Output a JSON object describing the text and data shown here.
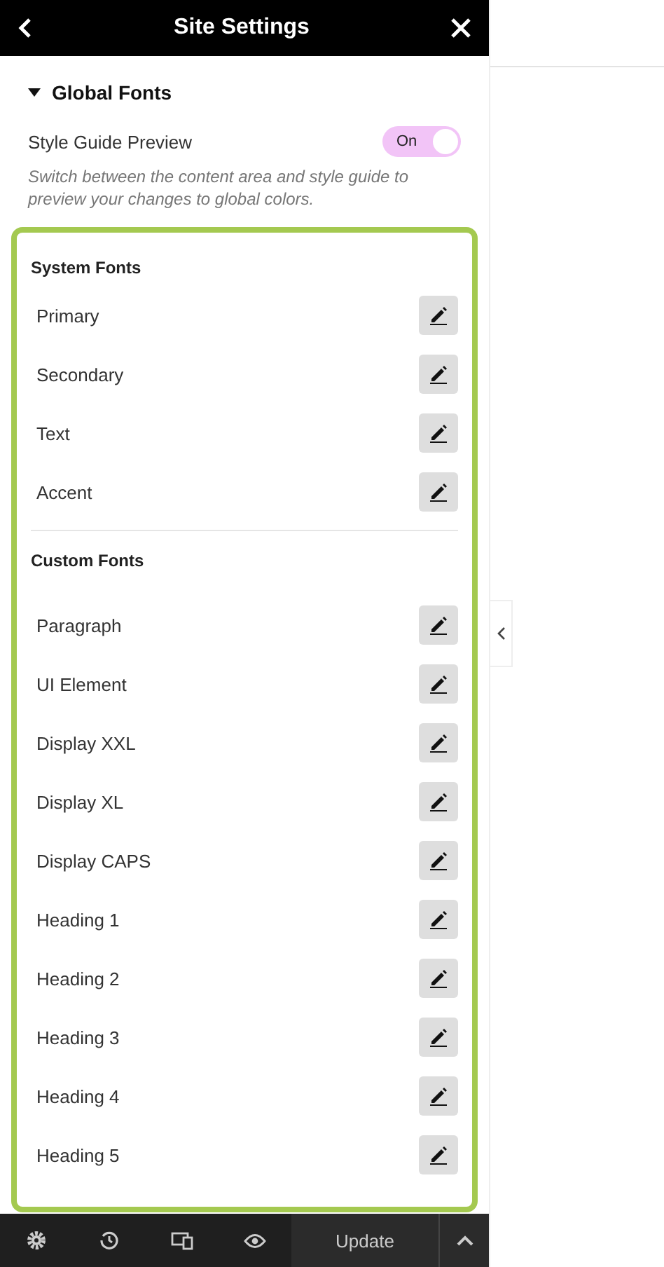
{
  "header": {
    "title": "Site Settings"
  },
  "section": {
    "title": "Global Fonts",
    "expanded": true
  },
  "style_guide": {
    "label": "Style Guide Preview",
    "toggle_text": "On",
    "on": true,
    "help": "Switch between the content area and style guide to preview your changes to global colors."
  },
  "groups": [
    {
      "title": "System Fonts",
      "items": [
        "Primary",
        "Secondary",
        "Text",
        "Accent"
      ]
    },
    {
      "title": "Custom Fonts",
      "items": [
        "Paragraph",
        "UI Element",
        "Display XXL",
        "Display XL",
        "Display CAPS",
        "Heading 1",
        "Heading 2",
        "Heading 3",
        "Heading 4",
        "Heading 5"
      ]
    }
  ],
  "footer": {
    "update_label": "Update"
  }
}
